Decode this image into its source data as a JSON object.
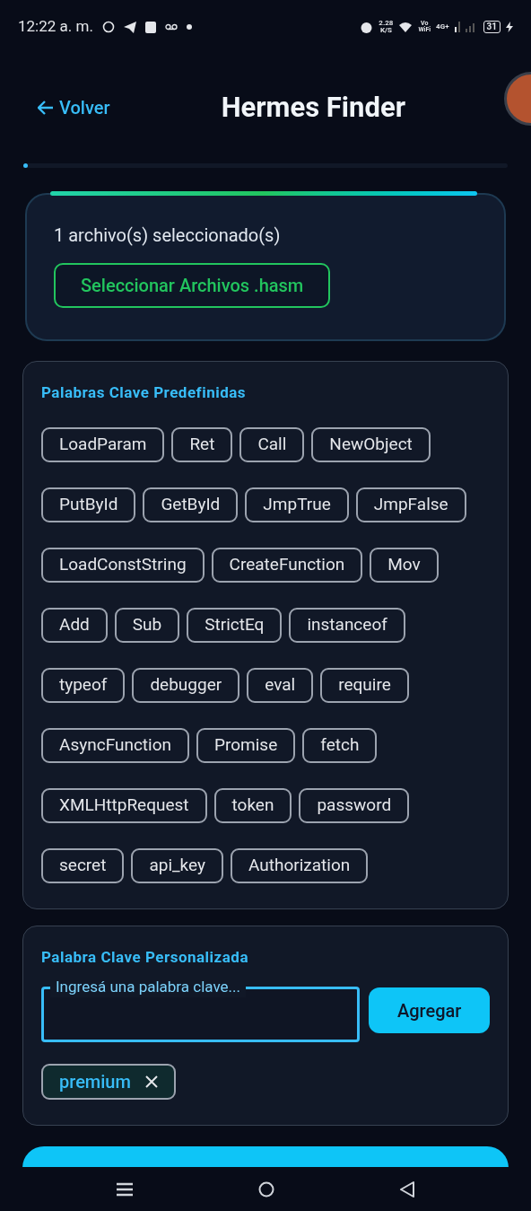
{
  "status_bar": {
    "time": "12:22 a. m.",
    "speed": "2.28",
    "speed_unit": "K/S",
    "volte_top": "Vo",
    "volte_bottom": "WiFi",
    "network": "4G+",
    "battery": "31"
  },
  "header": {
    "back": "Volver",
    "title": "Hermes Finder"
  },
  "progress": {
    "level": 0.01
  },
  "file_card": {
    "status": "1 archivo(s) seleccionado(s)",
    "button": "Seleccionar Archivos .hasm"
  },
  "predefined": {
    "title": "Palabras Clave Predefinidas",
    "keywords": [
      "LoadParam",
      "Ret",
      "Call",
      "NewObject",
      "PutById",
      "GetById",
      "JmpTrue",
      "JmpFalse",
      "LoadConstString",
      "CreateFunction",
      "Mov",
      "Add",
      "Sub",
      "StrictEq",
      "instanceof",
      "typeof",
      "debugger",
      "eval",
      "require",
      "AsyncFunction",
      "Promise",
      "fetch",
      "XMLHttpRequest",
      "token",
      "password",
      "secret",
      "api_key",
      "Authorization"
    ]
  },
  "custom": {
    "title": "Palabra Clave Personalizada",
    "field_label": "Ingresá una palabra clave...",
    "add_button": "Agregar",
    "tags": [
      "premium"
    ]
  }
}
